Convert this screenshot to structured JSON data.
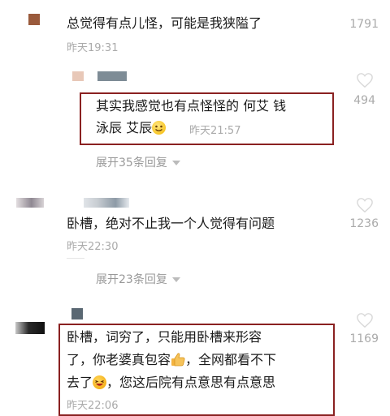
{
  "comments": [
    {
      "text": "总觉得有点儿怪，可能是我狭隘了",
      "time": "昨天19:31",
      "likes": "1791"
    },
    {
      "text_line1": "其实我感觉也有点怪怪的 何艾 钱",
      "text_line2": "泳辰 艾辰",
      "time": "昨天21:57",
      "likes": "494"
    },
    {
      "text": "卧槽，绝对不止我一个人觉得有问题",
      "time": "昨天22:30",
      "likes": "1236"
    },
    {
      "text_line1": "卧槽，词穷了，只能用卧槽来形容",
      "text_line2a": "了，你老婆真包容",
      "text_line2b": "，全网都看不下",
      "text_line3a": "去了",
      "text_line3b": "，您这后院有点意思有点意思",
      "time": "昨天22:06",
      "likes": "1169"
    }
  ],
  "expand_replies": [
    {
      "label": "展开35条回复"
    },
    {
      "label": "展开23条回复"
    }
  ],
  "colors": {
    "highlight_border": "#8a2121",
    "muted_text": "#aaaaaa"
  },
  "icons": [
    "heart-outline-icon",
    "smile-emoji-icon",
    "thumbs-up-emoji-icon",
    "laughing-emoji-icon",
    "dropdown-triangle-icon"
  ]
}
